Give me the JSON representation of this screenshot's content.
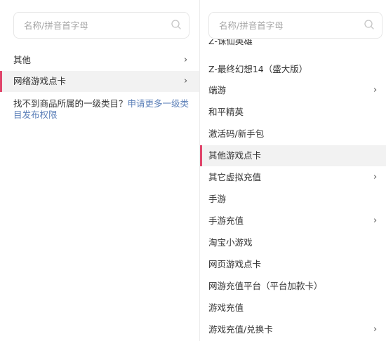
{
  "left": {
    "search_placeholder": "名称/拼音首字母",
    "categories": [
      {
        "label": "其他",
        "has_children": true,
        "selected": false
      },
      {
        "label": "网络游戏点卡",
        "has_children": true,
        "selected": true
      }
    ],
    "hint_text": "找不到商品所属的一级类目？",
    "hint_link": "申请更多一级类目发布权限"
  },
  "right": {
    "search_placeholder": "名称/拼音首字母",
    "partial_item": "Z-诛仙英雄",
    "items": [
      {
        "label": "Z-最终幻想14（盛大版）",
        "has_children": false,
        "selected": false
      },
      {
        "label": "端游",
        "has_children": true,
        "selected": false
      },
      {
        "label": "和平精英",
        "has_children": false,
        "selected": false
      },
      {
        "label": "激活码/新手包",
        "has_children": false,
        "selected": false
      },
      {
        "label": "其他游戏点卡",
        "has_children": false,
        "selected": true
      },
      {
        "label": "其它虚拟充值",
        "has_children": true,
        "selected": false
      },
      {
        "label": "手游",
        "has_children": false,
        "selected": false
      },
      {
        "label": "手游充值",
        "has_children": true,
        "selected": false
      },
      {
        "label": "淘宝小游戏",
        "has_children": false,
        "selected": false
      },
      {
        "label": "网页游戏点卡",
        "has_children": false,
        "selected": false
      },
      {
        "label": "网游充值平台（平台加款卡）",
        "has_children": false,
        "selected": false
      },
      {
        "label": "游戏充值",
        "has_children": false,
        "selected": false
      },
      {
        "label": "游戏充值/兑换卡",
        "has_children": true,
        "selected": false
      }
    ]
  },
  "icons": {
    "search": "search-icon",
    "chevron": "chevron-right-icon"
  },
  "colors": {
    "accent": "#e0456b",
    "selected_bg": "#f2f2f2",
    "link": "#5b7fb8",
    "border": "#e6e6e6"
  }
}
